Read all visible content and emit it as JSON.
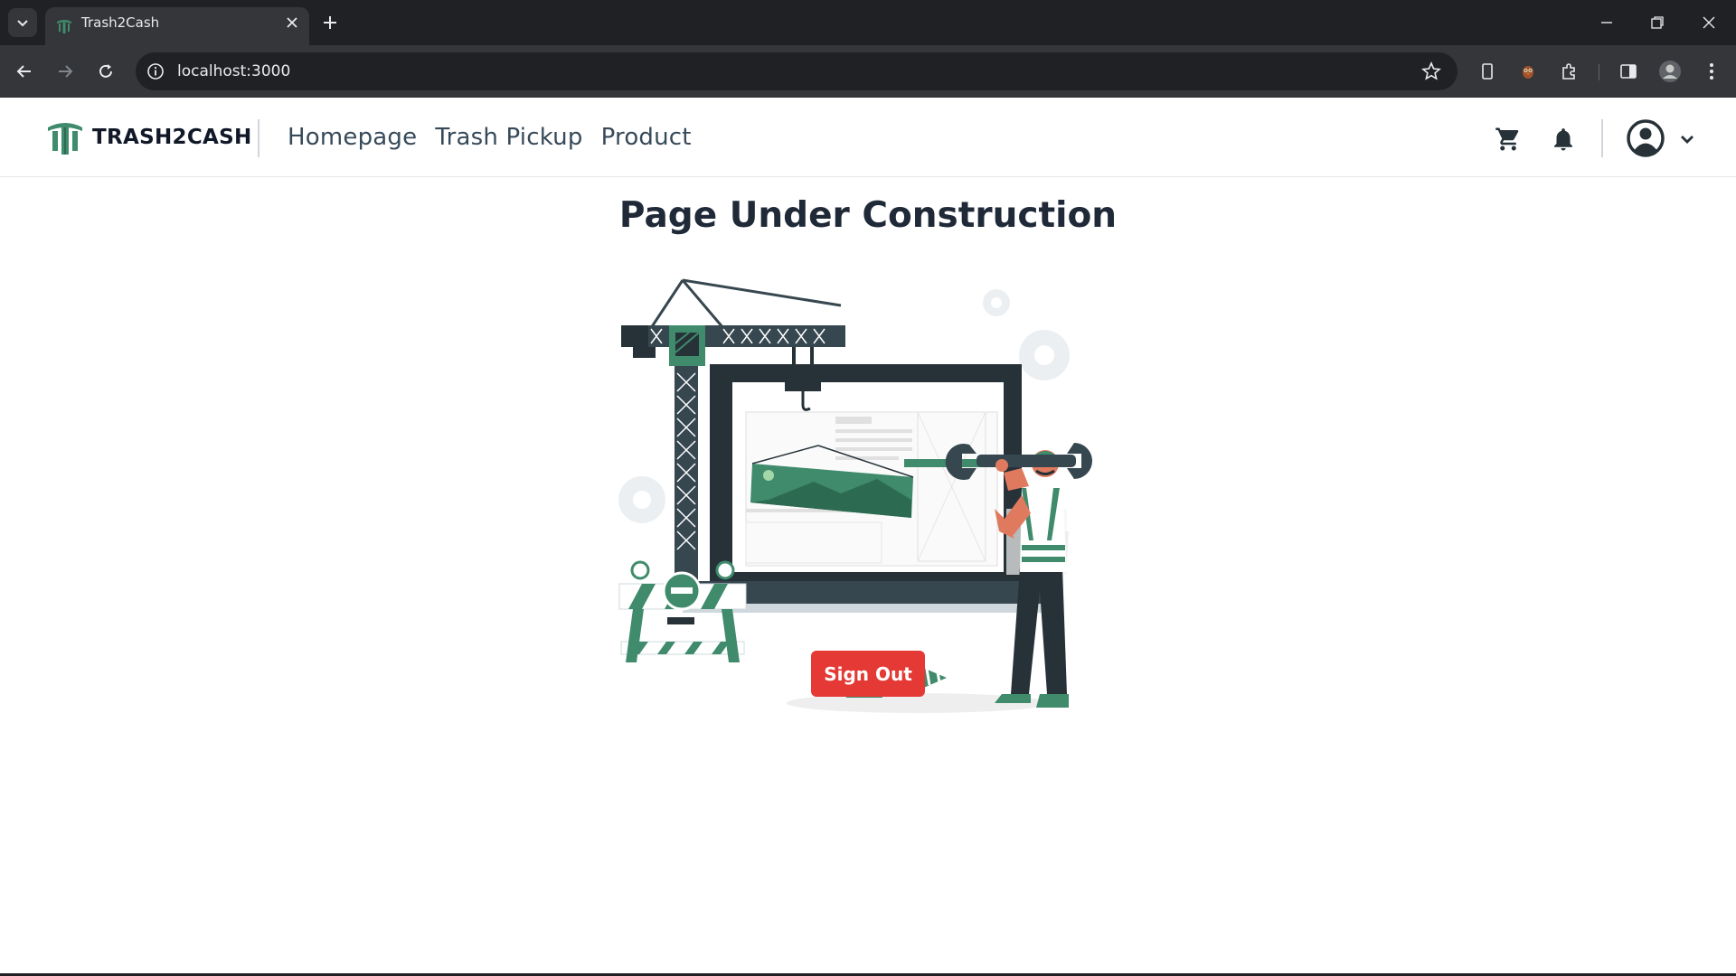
{
  "browser": {
    "tab": {
      "title": "Trash2Cash"
    },
    "address_bar": {
      "url": "localhost:3000"
    }
  },
  "site": {
    "brand": {
      "name": "TRASH2CASH"
    },
    "nav": [
      {
        "label": "Homepage"
      },
      {
        "label": "Trash Pickup"
      },
      {
        "label": "Product"
      }
    ],
    "icons": [
      "cart-icon",
      "bell-icon",
      "user-account-icon",
      "chevron-down-icon"
    ]
  },
  "main": {
    "title": "Page Under Construction",
    "signout_label": "Sign Out"
  },
  "colors": {
    "brand_green": "#3f8b6c",
    "dark_slate": "#263238",
    "signout_red": "#e53935",
    "chrome_dark": "#202124",
    "chrome_tab": "#35363a"
  }
}
